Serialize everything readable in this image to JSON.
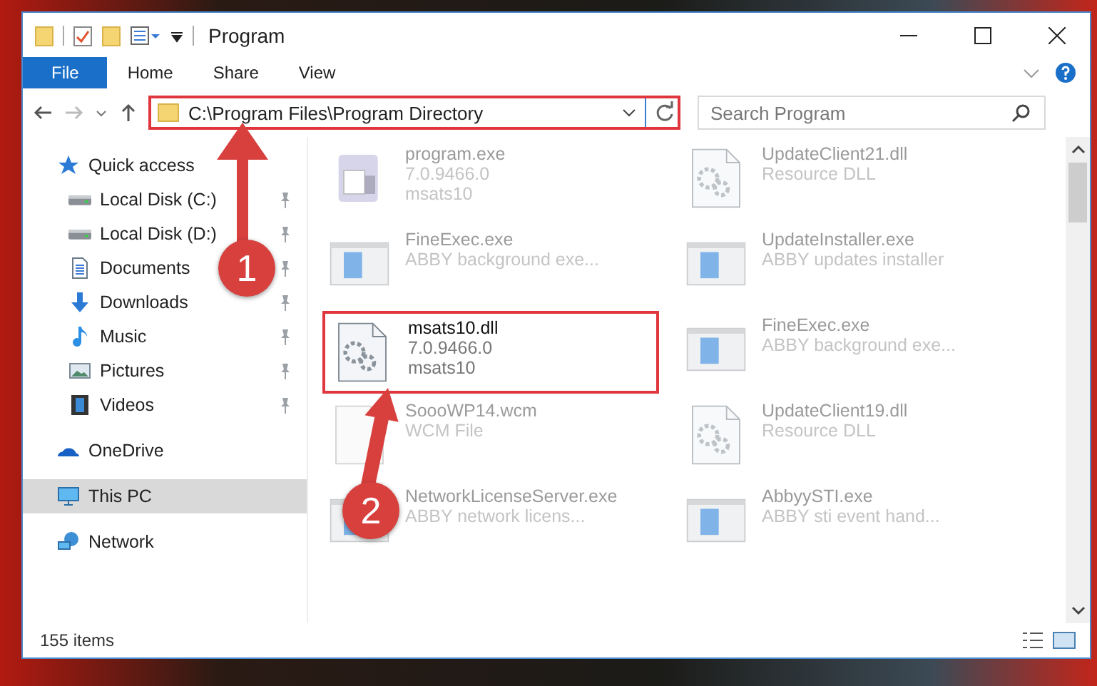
{
  "window": {
    "title": "Program"
  },
  "ribbon": {
    "tabs": [
      {
        "label": "File",
        "selected": true
      },
      {
        "label": "Home",
        "selected": false
      },
      {
        "label": "Share",
        "selected": false
      },
      {
        "label": "View",
        "selected": false
      }
    ]
  },
  "address_bar": {
    "path": "C:\\Program Files\\Program Directory",
    "highlighted": true
  },
  "search": {
    "placeholder": "Search Program"
  },
  "navigation": [
    {
      "label": "Quick access",
      "kind": "star",
      "selected": false,
      "children": [
        {
          "label": "Local Disk (C:)",
          "kind": "drive",
          "pinned": true,
          "selected": false
        },
        {
          "label": "Local Disk (D:)",
          "kind": "drive",
          "pinned": true,
          "selected": false
        },
        {
          "label": "Documents",
          "kind": "document",
          "pinned": true,
          "selected": false
        },
        {
          "label": "Downloads",
          "kind": "download",
          "pinned": true,
          "selected": false
        },
        {
          "label": "Music",
          "kind": "music",
          "pinned": true,
          "selected": false
        },
        {
          "label": "Pictures",
          "kind": "picture",
          "pinned": true,
          "selected": false
        },
        {
          "label": "Videos",
          "kind": "video",
          "pinned": true,
          "selected": false
        }
      ]
    },
    {
      "label": "OneDrive",
      "kind": "cloud",
      "selected": false
    },
    {
      "label": "This PC",
      "kind": "monitor",
      "selected": true
    },
    {
      "label": "Network",
      "kind": "network",
      "selected": false
    }
  ],
  "files": [
    {
      "name": "program.exe",
      "lines": [
        "7.0.9466.0",
        "msats10"
      ],
      "kind": "app",
      "blurred": true,
      "highlighted": false
    },
    {
      "name": "UpdateClient21.dll",
      "lines": [
        "Resource DLL"
      ],
      "kind": "dll",
      "blurred": true,
      "highlighted": false
    },
    {
      "name": "FineExec.exe",
      "lines": [
        "ABBY background exe..."
      ],
      "kind": "window",
      "blurred": true,
      "highlighted": false
    },
    {
      "name": "UpdateInstaller.exe",
      "lines": [
        "ABBY updates installer"
      ],
      "kind": "window",
      "blurred": true,
      "highlighted": false
    },
    {
      "name": "msats10.dll",
      "lines": [
        "7.0.9466.0",
        "msats10"
      ],
      "kind": "dll",
      "blurred": false,
      "highlighted": true
    },
    {
      "name": "FineExec.exe",
      "lines": [
        "ABBY background exe..."
      ],
      "kind": "window",
      "blurred": true,
      "highlighted": false
    },
    {
      "name": "SoooWP14.wcm",
      "lines": [
        "WCM File"
      ],
      "kind": "blank",
      "blurred": true,
      "highlighted": false
    },
    {
      "name": "UpdateClient19.dll",
      "lines": [
        "Resource DLL"
      ],
      "kind": "dll",
      "blurred": true,
      "highlighted": false
    },
    {
      "name": "NetworkLicenseServer.exe",
      "lines": [
        "ABBY network licens..."
      ],
      "kind": "window",
      "blurred": true,
      "highlighted": false
    },
    {
      "name": "AbbyySTI.exe",
      "lines": [
        "ABBY sti event hand..."
      ],
      "kind": "window",
      "blurred": true,
      "highlighted": false
    }
  ],
  "status_bar": {
    "item_count": "155 items"
  },
  "annotations": [
    {
      "number": "1"
    },
    {
      "number": "2"
    }
  ]
}
